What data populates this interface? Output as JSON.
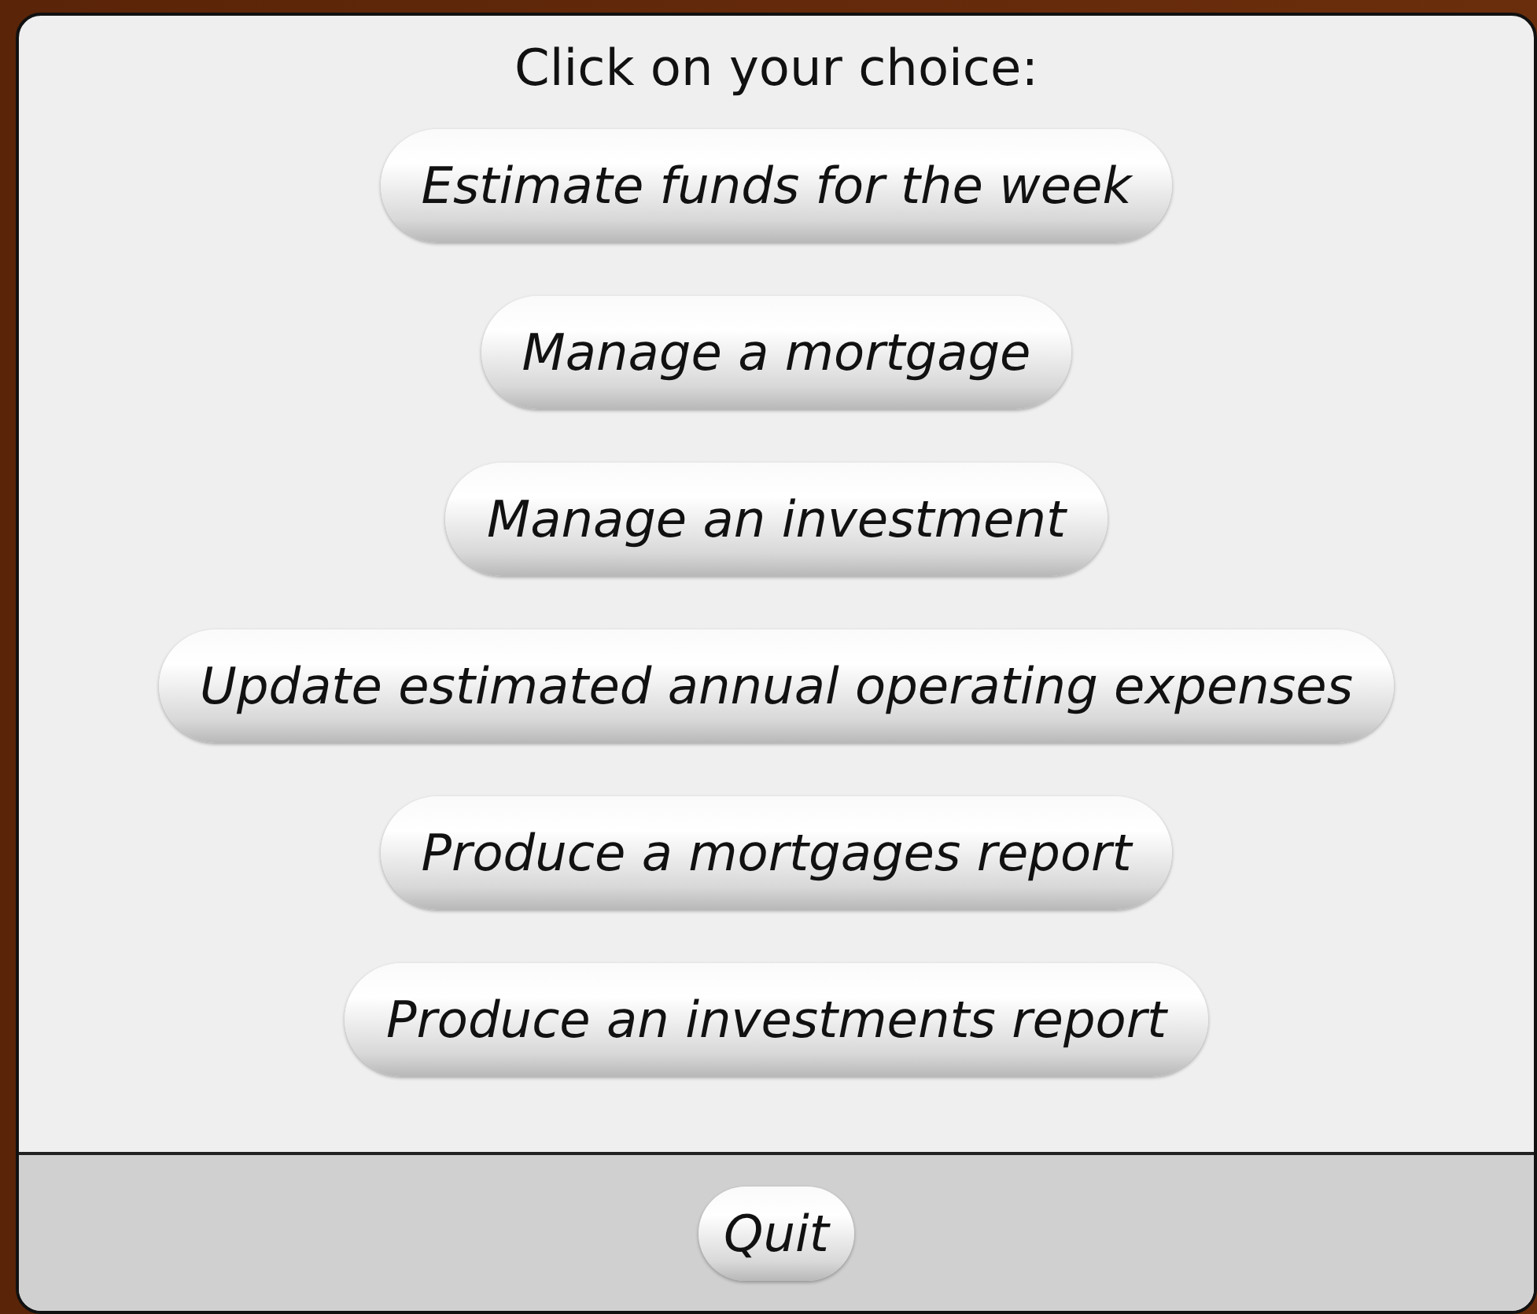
{
  "prompt": "Click on your choice:",
  "options": [
    "Estimate funds for the week",
    "Manage a mortgage",
    "Manage an investment",
    "Update estimated annual operating expenses",
    "Produce a mortgages report",
    "Produce an investments report"
  ],
  "footer_buttons": [
    "Quit"
  ]
}
